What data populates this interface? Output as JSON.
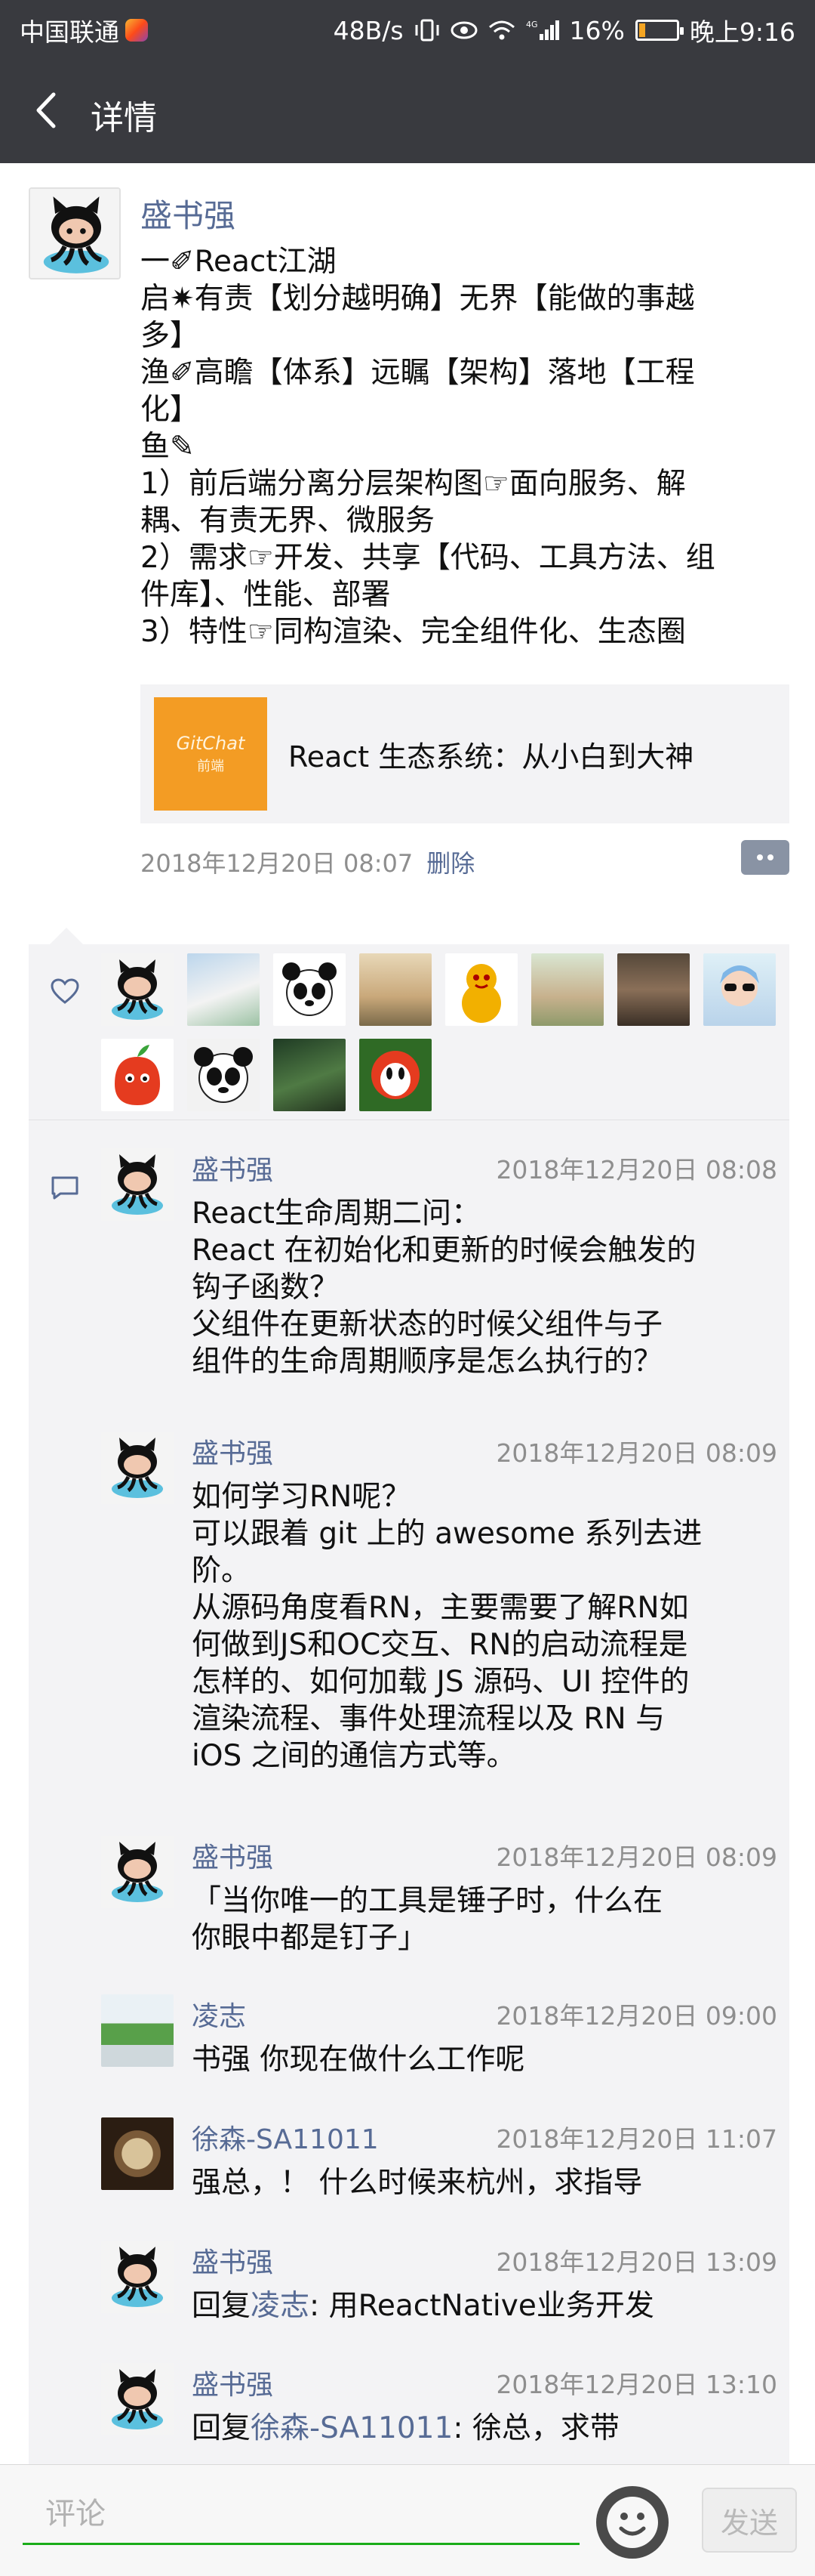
{
  "status_bar": {
    "carrier": "中国联通",
    "speed": "48B/s",
    "network": "4G",
    "battery": "16%",
    "battery_level": 0.16,
    "time": "晚上9:16"
  },
  "header": {
    "title": "详情"
  },
  "post": {
    "author": "盛书强",
    "lines": [
      "一✐React江湖",
      "启✷有责【划分越明确】无界【能做的事越",
      "多】",
      "渔✐高瞻【体系】远瞩【架构】落地【工程",
      "化】",
      "鱼✎",
      "1）前后端分离分层架构图☞面向服务、解",
      "耦、有责无界、微服务",
      "2）需求☞开发、共享【代码、工具方法、组",
      "件库】、性能、部署",
      "3）特性☞同构渲染、完全组件化、生态圈"
    ],
    "share": {
      "thumb_line1": "GitChat",
      "thumb_line2": "前端",
      "title": "React 生态系统：从小白到大神"
    },
    "time": "2018年12月20日 08:07",
    "delete_label": "删除"
  },
  "comments": [
    {
      "name": "盛书强",
      "time": "2018年12月20日 08:08",
      "lines": [
        "React生命周期二问：",
        "React 在初始化和更新的时候会触发的",
        "钩子函数？",
        "父组件在更新状态的时候父组件与子",
        "组件的生命周期顺序是怎么执行的？"
      ]
    },
    {
      "name": "盛书强",
      "time": "2018年12月20日 08:09",
      "lines": [
        "如何学习RN呢？",
        "可以跟着 git 上的 awesome 系列去进",
        "阶。",
        "从源码角度看RN，主要需要了解RN如",
        "何做到JS和OC交互、RN的启动流程是",
        "怎样的、如何加载 JS 源码、UI 控件的",
        "渲染流程、事件处理流程以及 RN 与",
        "iOS 之间的通信方式等。"
      ]
    },
    {
      "name": "盛书强",
      "time": "2018年12月20日 08:09",
      "lines": [
        "「当你唯一的工具是锤子时，什么在",
        "你眼中都是钉子」"
      ]
    },
    {
      "name": "凌志",
      "time": "2018年12月20日 09:00",
      "lines": [
        "书强 你现在做什么工作呢"
      ]
    },
    {
      "name": "徐森-SA11011",
      "time": "2018年12月20日 11:07",
      "lines": [
        "强总，！ 什么时候来杭州，求指导"
      ]
    },
    {
      "name": "盛书强",
      "time": "2018年12月20日 13:09",
      "reply_prefix": "回复",
      "reply_to": "凌志",
      "reply_text": ": 用ReactNative业务开发"
    },
    {
      "name": "盛书强",
      "time": "2018年12月20日 13:10",
      "reply_prefix": "回复",
      "reply_to": "徐森-SA11011",
      "reply_text": ": 徐总，求带"
    }
  ],
  "bottom_bar": {
    "placeholder": "评论",
    "send_label": "发送"
  },
  "colors": {
    "nav_bg": "#393a3f",
    "link_blue": "#576b95",
    "panel_bg": "#f3f3f5",
    "input_underline": "#1aad19"
  }
}
